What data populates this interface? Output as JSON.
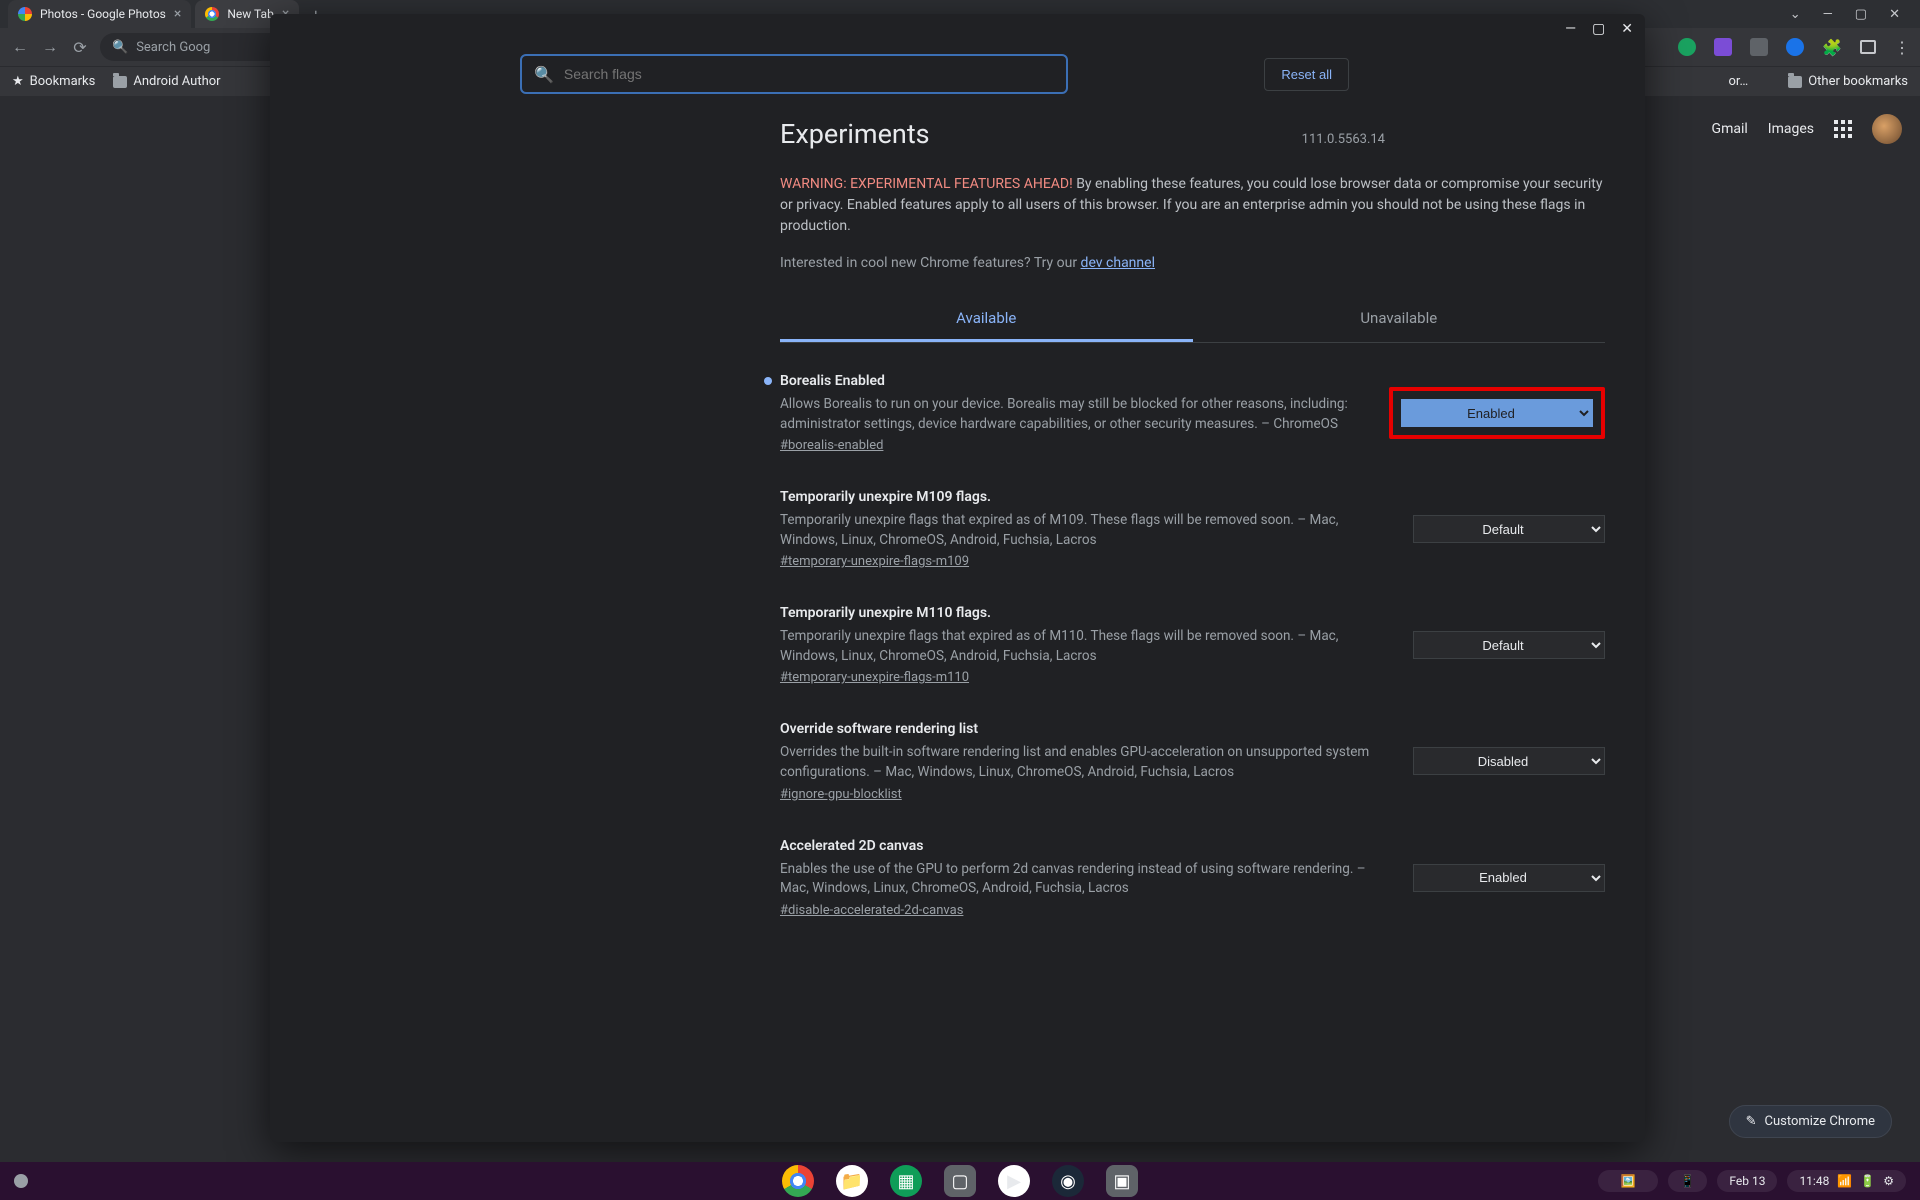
{
  "browser": {
    "tabs": [
      {
        "title": "Photos - Google Photos"
      },
      {
        "title": "New Tab"
      }
    ],
    "omnibox_placeholder": "Search Goog",
    "bookmarks": {
      "bookmarks_label": "Bookmarks",
      "folder1": "Android Author",
      "more": "or…",
      "other": "Other bookmarks"
    },
    "ntp": {
      "gmail": "Gmail",
      "images": "Images",
      "customize": "Customize Chrome"
    }
  },
  "flags": {
    "search_placeholder": "Search flags",
    "reset": "Reset all",
    "title": "Experiments",
    "version": "111.0.5563.14",
    "warning_label": "WARNING: EXPERIMENTAL FEATURES AHEAD!",
    "warning_text": " By enabling these features, you could lose browser data or compromise your security or privacy. Enabled features apply to all users of this browser. If you are an enterprise admin you should not be using these flags in production.",
    "dev_prefix": "Interested in cool new Chrome features? Try our ",
    "dev_link": "dev channel",
    "tabs": {
      "available": "Available",
      "unavailable": "Unavailable"
    },
    "items": [
      {
        "title": "Borealis Enabled",
        "desc": "Allows Borealis to run on your device. Borealis may still be blocked for other reasons, including: administrator settings, device hardware capabilities, or other security measures. – ChromeOS",
        "hash": "#borealis-enabled",
        "value": "Enabled",
        "modified": true,
        "highlight": true
      },
      {
        "title": "Temporarily unexpire M109 flags.",
        "desc": "Temporarily unexpire flags that expired as of M109. These flags will be removed soon. – Mac, Windows, Linux, ChromeOS, Android, Fuchsia, Lacros",
        "hash": "#temporary-unexpire-flags-m109",
        "value": "Default"
      },
      {
        "title": "Temporarily unexpire M110 flags.",
        "desc": "Temporarily unexpire flags that expired as of M110. These flags will be removed soon. – Mac, Windows, Linux, ChromeOS, Android, Fuchsia, Lacros",
        "hash": "#temporary-unexpire-flags-m110",
        "value": "Default"
      },
      {
        "title": "Override software rendering list",
        "desc": "Overrides the built-in software rendering list and enables GPU-acceleration on unsupported system configurations. – Mac, Windows, Linux, ChromeOS, Android, Fuchsia, Lacros",
        "hash": "#ignore-gpu-blocklist",
        "value": "Disabled"
      },
      {
        "title": "Accelerated 2D canvas",
        "desc": "Enables the use of the GPU to perform 2d canvas rendering instead of using software rendering. – Mac, Windows, Linux, ChromeOS, Android, Fuchsia, Lacros",
        "hash": "#disable-accelerated-2d-canvas",
        "value": "Enabled"
      }
    ]
  },
  "shelf": {
    "date": "Feb 13",
    "time": "11:48"
  }
}
